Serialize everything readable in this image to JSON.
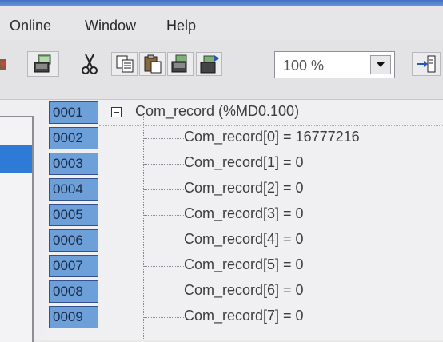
{
  "menu": {
    "items": [
      {
        "label": "Online"
      },
      {
        "label": "Window"
      },
      {
        "label": "Help"
      }
    ]
  },
  "toolbar": {
    "zoom": {
      "value": "100 %"
    }
  },
  "rows": [
    {
      "num": "0001",
      "text": "Com_record (%MD0.100)"
    },
    {
      "num": "0002",
      "text": "Com_record[0] = 16777216"
    },
    {
      "num": "0003",
      "text": "Com_record[1] = 0"
    },
    {
      "num": "0004",
      "text": "Com_record[2] = 0"
    },
    {
      "num": "0005",
      "text": "Com_record[3] = 0"
    },
    {
      "num": "0006",
      "text": "Com_record[4] = 0"
    },
    {
      "num": "0007",
      "text": "Com_record[5] = 0"
    },
    {
      "num": "0008",
      "text": "Com_record[6] = 0"
    },
    {
      "num": "0009",
      "text": "Com_record[7] = 0"
    }
  ]
}
